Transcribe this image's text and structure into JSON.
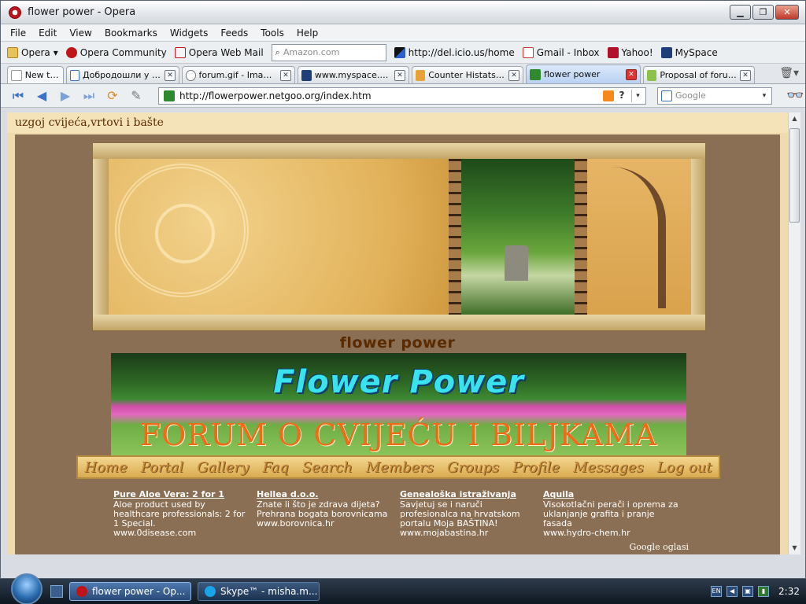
{
  "window": {
    "title": "flower power - Opera",
    "controls": {
      "minimize": "▁",
      "maximize": "❐",
      "close": "✕"
    }
  },
  "menu": [
    "File",
    "Edit",
    "View",
    "Bookmarks",
    "Widgets",
    "Feeds",
    "Tools",
    "Help"
  ],
  "bookmarks": {
    "opera": "Opera",
    "community": "Opera Community",
    "webmail": "Opera Web Mail",
    "search_placeholder": "Amazon.com",
    "delicious": "http://del.icio.us/home",
    "gmail": "Gmail - Inbox",
    "yahoo": "Yahoo!",
    "myspace": "MySpace"
  },
  "tabs": [
    {
      "label": "New tab",
      "closable": false,
      "active": false
    },
    {
      "label": "Добродошли у Gmail",
      "closable": true,
      "active": false
    },
    {
      "label": "forum.gif - Image -...",
      "closable": true,
      "active": false
    },
    {
      "label": "www.myspace.co...",
      "closable": true,
      "active": false
    },
    {
      "label": "Counter Histats.co...",
      "closable": true,
      "active": false
    },
    {
      "label": "flower power",
      "closable": true,
      "active": true
    },
    {
      "label": "Proposal of forum ...",
      "closable": true,
      "active": false
    }
  ],
  "navigation": {
    "address": "http://flowerpower.netgoo.org/index.htm",
    "search_placeholder": "Google"
  },
  "page": {
    "header": "uzgoj cvijeća,vrtovi i bašte",
    "site_title": "flower power",
    "forum_banner_title": "Flower Power",
    "forum_banner_subtitle": "FORUM O CVIJEĆU I BILJKAMA",
    "nav_links": [
      "Home",
      "Portal",
      "Gallery",
      "Faq",
      "Search",
      "Members",
      "Groups",
      "Profile",
      "Messages",
      "Log out"
    ],
    "ads": [
      {
        "title": "Pure Aloe Vera: 2 for 1",
        "text": "Aloe product used by healthcare professionals: 2 for 1 Special.",
        "url": "www.0disease.com"
      },
      {
        "title": "Hellea d.o.o.",
        "text": "Znate li što je zdrava dijeta? Prehrana bogata borovnicama",
        "url": "www.borovnica.hr"
      },
      {
        "title": "Genealoška istraživanja",
        "text": "Savjetuj se i naruči profesionalca na hrvatskom portalu Moja BAŠTINA!",
        "url": "www.mojabastina.hr"
      },
      {
        "title": "Aquila",
        "text": "Visokotlačni perači i oprema za uklanjanje grafita i pranje fasada",
        "url": "www.hydro-chem.hr"
      }
    ],
    "google_ads_label": "Google oglasi"
  },
  "taskbar": {
    "items": [
      {
        "label": "flower power - Op...",
        "active": true
      },
      {
        "label": "Skype™ - misha.m...",
        "active": false
      }
    ],
    "tray_lang": "EN",
    "clock": "2:32"
  },
  "colors": {
    "page_background": "#8b6f55",
    "header_text": "#5a2a00",
    "banner_title": "#39e3ee",
    "banner_subtitle": "#f06a18",
    "ad_text": "#ffffff"
  }
}
